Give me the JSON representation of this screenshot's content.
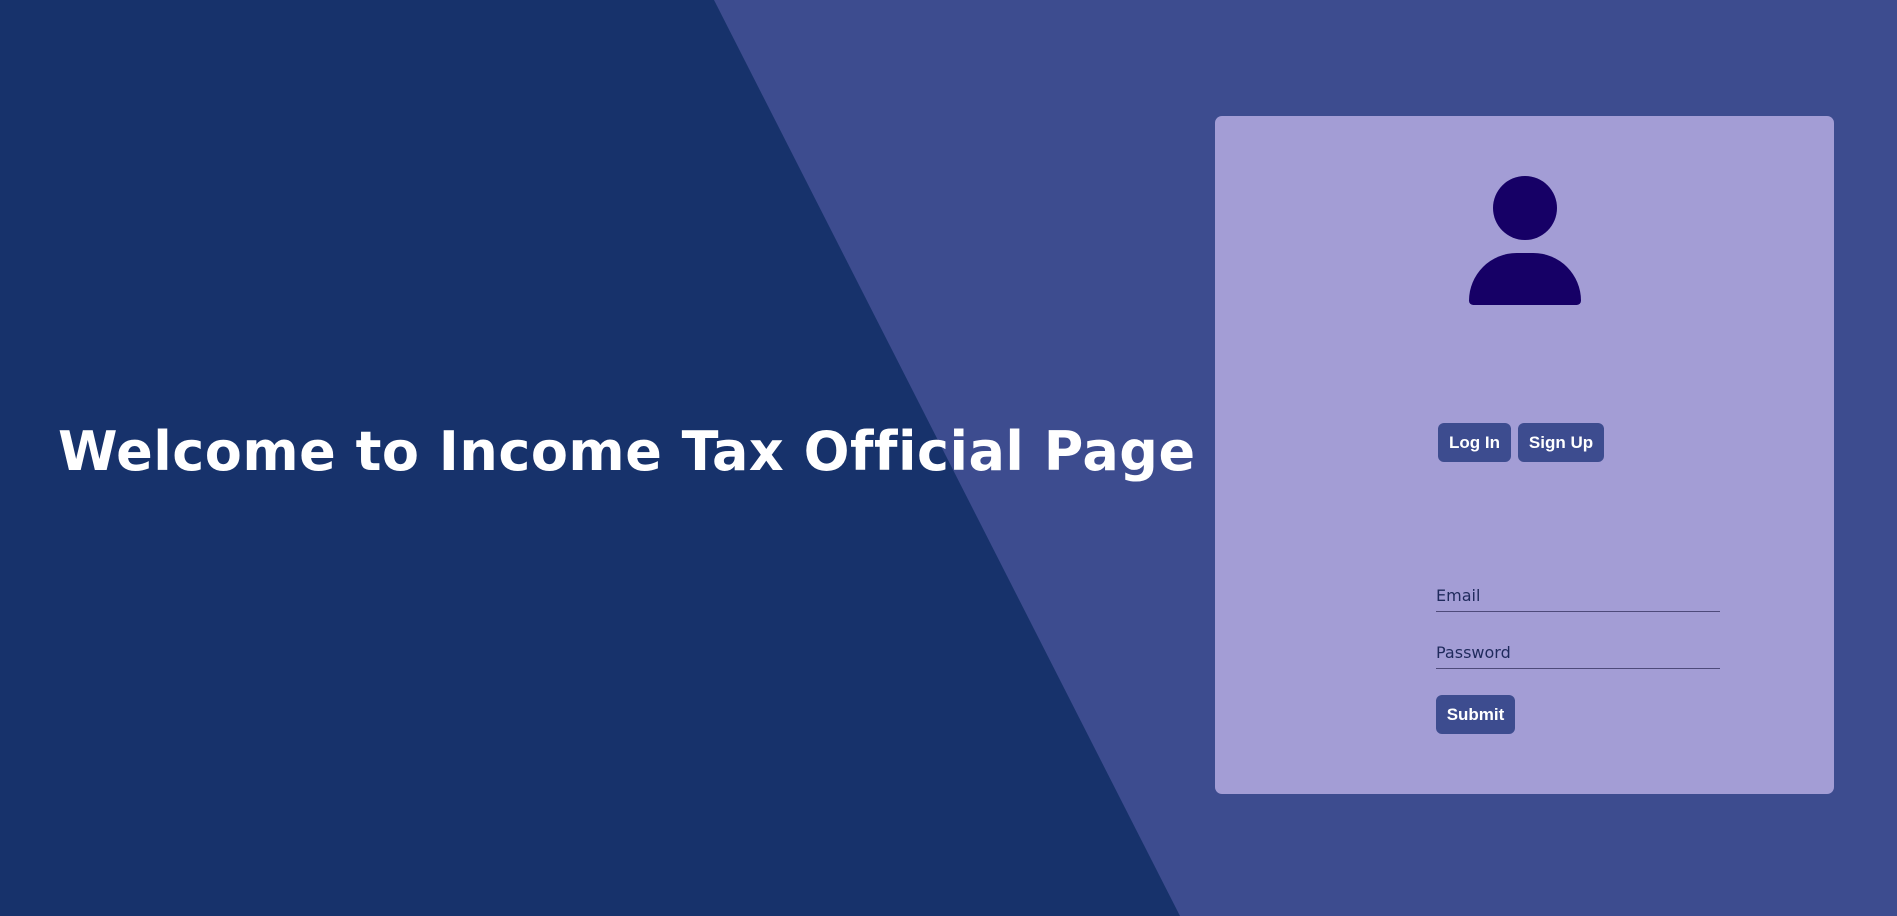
{
  "hero": {
    "title": "Welcome to Income Tax Official Page"
  },
  "auth_card": {
    "avatar_icon": "user-icon",
    "tabs": {
      "login_label": "Log In",
      "signup_label": "Sign Up"
    },
    "form": {
      "email_placeholder": "Email",
      "email_value": "",
      "password_placeholder": "Password",
      "password_value": "",
      "submit_label": "Submit"
    }
  },
  "colors": {
    "dark_panel": "#17326b",
    "background": "#3d4c8f",
    "card": "#a39dd5",
    "avatar": "#160066",
    "button": "#3d4c8f",
    "button_text": "#ffffff"
  }
}
